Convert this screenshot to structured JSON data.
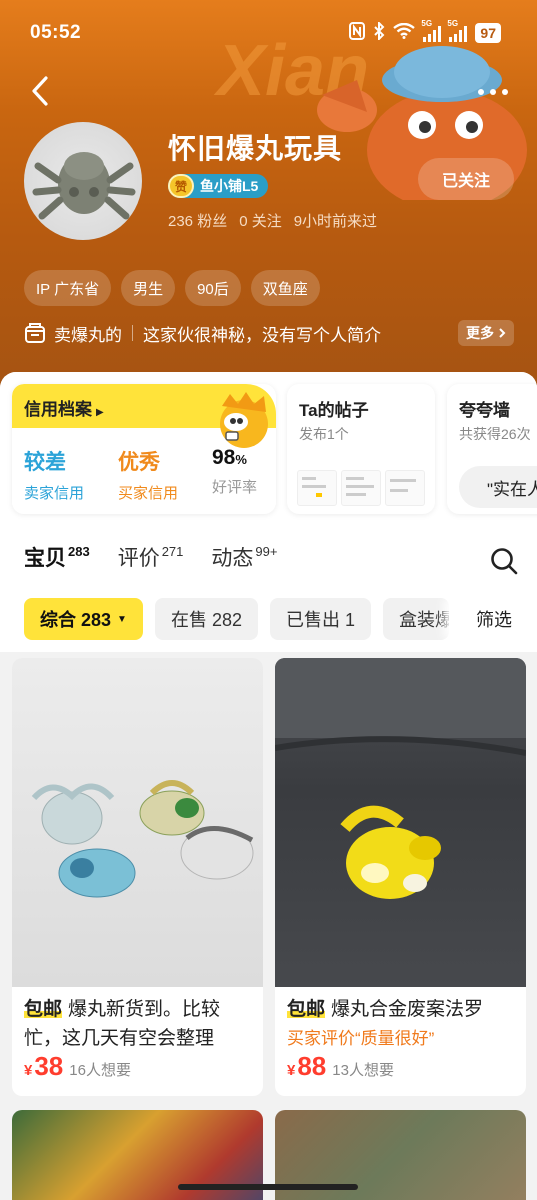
{
  "status_bar": {
    "time": "05:52",
    "network": "5G",
    "battery": "97"
  },
  "header": {
    "shop_name": "怀旧爆丸玩具",
    "level_coin": "赞",
    "level_badge": "鱼小铺L5",
    "follow_label": "已关注",
    "fans": "236 粉丝",
    "following": "0 关注",
    "last_seen": "9小时前来过",
    "tags": [
      "IP 广东省",
      "男生",
      "90后",
      "双鱼座"
    ],
    "shop_tagline": "卖爆丸的",
    "bio": "这家伙很神秘，没有写个人简介",
    "more_label": "更多"
  },
  "credit_card": {
    "title": "信用档案",
    "seller_value": "较差",
    "seller_label": "卖家信用",
    "buyer_value": "优秀",
    "buyer_label": "买家信用",
    "rate_value": "98",
    "rate_unit": "%",
    "rate_label": "好评率",
    "colors": {
      "seller": "#2ba3d8",
      "buyer": "#f08a1c",
      "accent": "#ffe33a"
    }
  },
  "posts_card": {
    "title": "Ta的帖子",
    "subtitle": "发布1个"
  },
  "praise_card": {
    "title": "夸夸墙",
    "subtitle": "共获得26次",
    "quote": "\"实在人"
  },
  "tabs": [
    {
      "label": "宝贝",
      "count": "283"
    },
    {
      "label": "评价",
      "count": "271"
    },
    {
      "label": "动态",
      "count": "99+"
    }
  ],
  "filters": {
    "sort_label": "综合 283",
    "on_sale": "在售 282",
    "sold": "已售出 1",
    "boxed": "盒装爆丸",
    "filter_label": "筛选"
  },
  "products": [
    {
      "shipping": "包邮",
      "title": "爆丸新货到。比较忙，这几天有空会整理",
      "review": "",
      "currency": "¥",
      "price": "38",
      "wants": "16人想要"
    },
    {
      "shipping": "包邮",
      "title": "爆丸合金废案法罗",
      "review": "买家评价“质量很好”",
      "currency": "¥",
      "price": "88",
      "wants": "13人想要"
    }
  ],
  "accent_color": "#ffe33a",
  "price_color": "#ff3d2e"
}
